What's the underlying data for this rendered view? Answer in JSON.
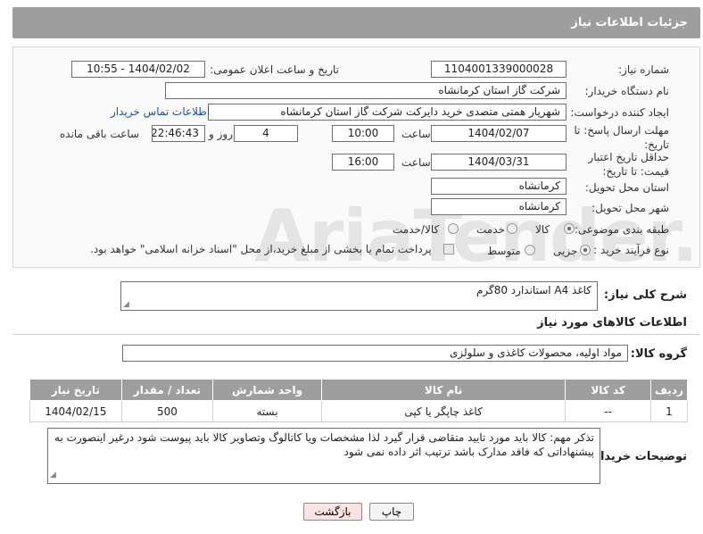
{
  "header": {
    "title": "جزئیات اطلاعات نیاز"
  },
  "labels": {
    "need_number": "شماره نیاز:",
    "announce_datetime": "تاریخ و ساعت اعلان عمومی:",
    "buyer_org": "نام دستگاه خریدار:",
    "requester": "ایجاد کننده درخواست:",
    "reply_deadline": "مهلت ارسال پاسخ: تا تاریخ:",
    "time": "ساعت",
    "day_and": "روز و",
    "hours_remaining": "ساعت باقی مانده",
    "price_validity": "حداقل تاریخ اعتبار قیمت: تا تاریخ:",
    "time2": "ساعت",
    "delivery_province": "استان محل تحویل:",
    "delivery_city": "شهر محل تحویل:",
    "subject_class": "طبقه بندی موضوعی:",
    "purchase_type": "نوع فرآیند خرید :"
  },
  "values": {
    "need_number": "1104001339000028",
    "announce_datetime": "1404/02/02 - 10:55",
    "buyer_org": "شرکت گاز استان کرمانشاه",
    "requester": "شهریار همتی متصدی خرید دایرکت شرکت گاز استان کرمانشاه",
    "buyer_contact_link": "اطلاعات تماس خریدار",
    "reply_date": "1404/02/07",
    "reply_time": "10:00",
    "days": "4",
    "countdown": "22:46:43",
    "validity_date": "1404/03/31",
    "validity_time": "16:00",
    "province": "کرمانشاه",
    "city": "کرمانشاه"
  },
  "subject_options": [
    {
      "label": "کالا",
      "selected": true
    },
    {
      "label": "خدمت",
      "selected": false
    },
    {
      "label": "کالا/خدمت",
      "selected": false
    }
  ],
  "purchase_options": [
    {
      "label": "جزیی",
      "selected": true
    },
    {
      "label": "متوسط",
      "selected": false
    }
  ],
  "payment_note": "پرداخت تمام یا بخشی از مبلغ خرید،از محل \"اسناد خزانه اسلامی\" خواهد بود.",
  "description": {
    "label": "شرح کلی نیاز:",
    "value": "کاغذ A4  استاندارد 80گرم"
  },
  "items_section": {
    "title": "اطلاعات کالاهای مورد نیاز",
    "group_label": "گروه کالا:",
    "group_value": "مواد اولیه، محصولات کاغذی و سلولزی"
  },
  "table": {
    "headers": [
      "ردیف",
      "کد کالا",
      "نام کالا",
      "واحد شمارش",
      "تعداد / مقدار",
      "تاریخ نیاز"
    ],
    "rows": [
      [
        "1",
        "--",
        "کاغذ چاپگر یا کپی",
        "بسته",
        "500",
        "1404/02/15"
      ]
    ]
  },
  "buyer_notes": {
    "label": "توضیحات خریدار:",
    "value": "تذکر مهم: کالا باید مورد تایید متقاضی قرار گیرد لذا مشخصات ویا کاتالوگ وتصاویر کالا باید پیوست شود درغیر اینصورت به پیشنهاداتی که فاقد مدارک باشد ترتیب اثر داده نمی شود"
  },
  "buttons": {
    "print": "چاپ",
    "back": "بازگشت"
  },
  "watermark": "AriaTender.neT",
  "colors": {
    "header_bg": "#9e9e9e",
    "link": "#1a4fa8",
    "back_button_bg": "#fbe3e3"
  }
}
